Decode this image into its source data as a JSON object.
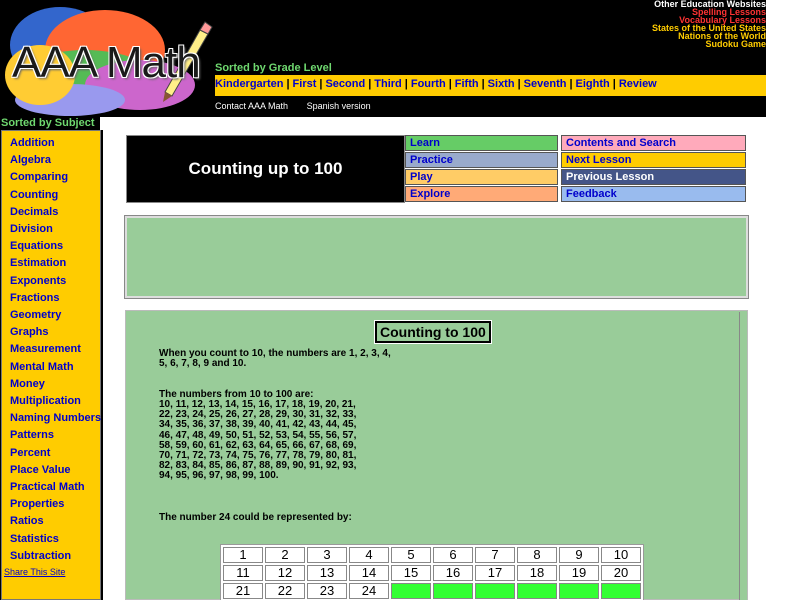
{
  "header": {
    "logo_text": "AAA Math",
    "external_links": [
      {
        "label": "Other Education Websites",
        "color": "#ffffff"
      },
      {
        "label": "Spelling Lessons",
        "color": "#ff3333"
      },
      {
        "label": "Vocabulary Lessons",
        "color": "#ff3333"
      },
      {
        "label": "States of the United States",
        "color": "#ffcc00"
      },
      {
        "label": "Nations of the World",
        "color": "#ffcc00"
      },
      {
        "label": "Sudoku Game",
        "color": "#ffcc00"
      }
    ],
    "sorted_by_grade_label": "Sorted by Grade Level",
    "grade_links": [
      "Kindergarten",
      "First",
      "Second",
      "Third",
      "Fourth",
      "Fifth",
      "Sixth",
      "Seventh",
      "Eighth",
      "Review"
    ],
    "contact_link": "Contact AAA Math",
    "spanish_link": "Spanish version"
  },
  "sidebar": {
    "sorted_by_subject_label": "Sorted by Subject",
    "subjects": [
      "Addition",
      "Algebra",
      "Comparing",
      "Counting",
      "Decimals",
      "Division",
      "Equations",
      "Estimation",
      "Exponents",
      "Fractions",
      "Geometry",
      "Graphs",
      "Measurement",
      "Mental Math",
      "Money",
      "Multiplication",
      "Naming Numbers",
      "Patterns",
      "Percent",
      "Place Value",
      "Practical Math",
      "Properties",
      "Ratios",
      "Statistics",
      "Subtraction"
    ],
    "share_link": "Share This Site"
  },
  "lesson": {
    "title": "Counting up to 100",
    "nav": {
      "learn": "Learn",
      "practice": "Practice",
      "play": "Play",
      "explore": "Explore",
      "contents_search": "Contents and Search",
      "next_lesson": "Next Lesson",
      "previous_lesson": "Previous Lesson",
      "feedback": "Feedback"
    }
  },
  "content": {
    "heading": "Counting to 100",
    "para1": "When you count to 10, the numbers are 1, 2, 3, 4, 5, 6, 7, 8, 9 and 10.",
    "para2_intro": "The numbers from 10 to 100 are:",
    "para2_numbers": "10, 11, 12, 13, 14, 15, 16, 17, 18, 19, 20, 21, 22, 23, 24, 25, 26, 27, 28, 29, 30, 31, 32, 33, 34, 35, 36, 37, 38, 39, 40, 41, 42, 43, 44, 45, 46, 47, 48, 49, 50, 51, 52, 53, 54, 55, 56, 57, 58, 59, 60, 61, 62, 63, 64, 65, 66, 67, 68, 69, 70, 71, 72, 73, 74, 75, 76, 77, 78, 79, 80, 81, 82, 83, 84, 85, 86, 87, 88, 89, 90, 91, 92, 93, 94, 95, 96, 97, 98, 99, 100.",
    "para3": "The number 24 could be represented by:",
    "grid": [
      [
        "1",
        "2",
        "3",
        "4",
        "5",
        "6",
        "7",
        "8",
        "9",
        "10"
      ],
      [
        "11",
        "12",
        "13",
        "14",
        "15",
        "16",
        "17",
        "18",
        "19",
        "20"
      ],
      [
        "21",
        "22",
        "23",
        "24",
        "",
        "",
        "",
        "",
        "",
        ""
      ]
    ]
  },
  "colors": {
    "header_bg": "#000000",
    "yellow": "#ffcc00",
    "green_label": "#6fd86f",
    "content_green": "#99cc99",
    "link_blue": "#0000cc",
    "grid_empty": "#33ff33",
    "nav_learn": "#66cc66",
    "nav_practice": "#99aacc",
    "nav_play": "#ffcc66",
    "nav_explore": "#ffaa77",
    "nav_contents": "#ffaabb",
    "nav_next": "#ffcc00",
    "nav_previous": "#445588",
    "nav_feedback": "#99bbee"
  }
}
